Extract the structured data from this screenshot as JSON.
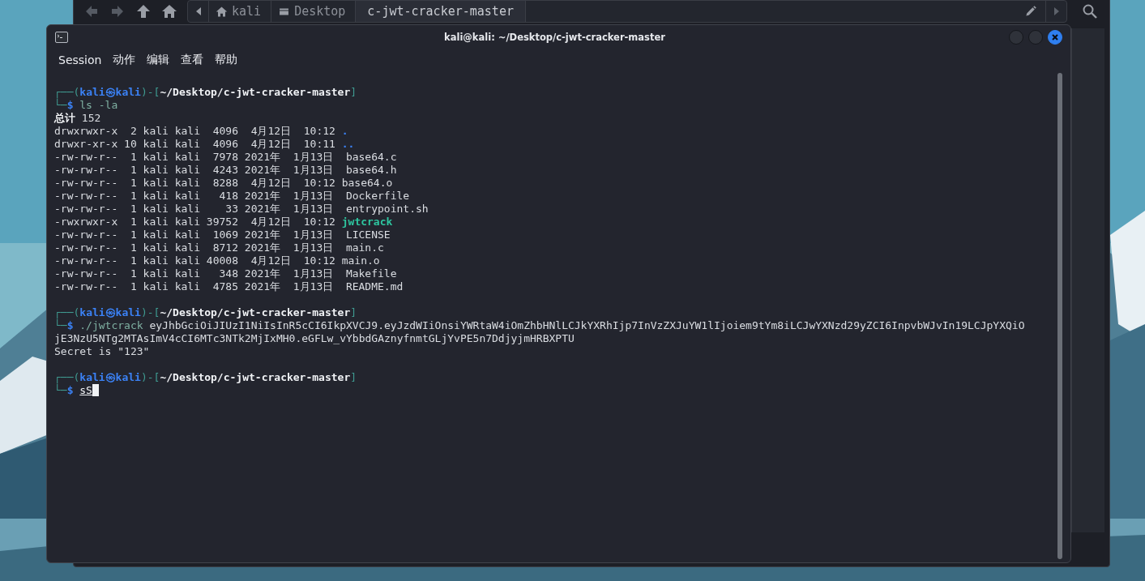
{
  "file_manager": {
    "breadcrumbs": [
      {
        "kind": "home",
        "label": "kali",
        "selected": false
      },
      {
        "kind": "drive",
        "label": "Desktop",
        "selected": false
      },
      {
        "kind": "folder",
        "label": "c-jwt-cracker-master",
        "selected": true
      }
    ]
  },
  "terminal": {
    "title": "kali@kali: ~/Desktop/c-jwt-cracker-master",
    "menu": [
      "Session",
      "动作",
      "编辑",
      "查看",
      "帮助"
    ],
    "cursor_visible": true,
    "blocks": [
      {
        "lines": [
          {
            "segments": [
              {
                "kind": "frame",
                "text": "┌──("
              },
              {
                "kind": "user",
                "text": "kali㉿kali"
              },
              {
                "kind": "frame",
                "text": ")-["
              },
              {
                "kind": "path",
                "text": "~/Desktop/c-jwt-cracker-master"
              },
              {
                "kind": "frame",
                "text": "]"
              }
            ]
          },
          {
            "segments": [
              {
                "kind": "frame",
                "text": "└─"
              },
              {
                "kind": "sign",
                "text": "$"
              },
              {
                "kind": "command",
                "text": "ls -la"
              }
            ]
          },
          {
            "segments": [
              {
                "kind": "heading",
                "text": "总计"
              },
              {
                "kind": "output",
                "text": " 152"
              }
            ]
          },
          {
            "segments": [
              {
                "kind": "output",
                "text": "drwxrwxr-x  2 kali kali  4096  4月12日  10:12 "
              },
              {
                "kind": "dir",
                "text": "."
              }
            ]
          },
          {
            "segments": [
              {
                "kind": "output",
                "text": "drwxr-xr-x 10 kali kali  4096  4月12日  10:11 "
              },
              {
                "kind": "dir",
                "text": ".."
              }
            ]
          },
          {
            "segments": [
              {
                "kind": "output",
                "text": "-rw-rw-r--  1 kali kali  7978 2021年  1月13日  base64.c"
              }
            ]
          },
          {
            "segments": [
              {
                "kind": "output",
                "text": "-rw-rw-r--  1 kali kali  4243 2021年  1月13日  base64.h"
              }
            ]
          },
          {
            "segments": [
              {
                "kind": "output",
                "text": "-rw-rw-r--  1 kali kali  8288  4月12日  10:12 base64.o"
              }
            ]
          },
          {
            "segments": [
              {
                "kind": "output",
                "text": "-rw-rw-r--  1 kali kali   418 2021年  1月13日  Dockerfile"
              }
            ]
          },
          {
            "segments": [
              {
                "kind": "output",
                "text": "-rw-rw-r--  1 kali kali    33 2021年  1月13日  entrypoint.sh"
              }
            ]
          },
          {
            "segments": [
              {
                "kind": "output",
                "text": "-rwxrwxr-x  1 kali kali 39752  4月12日  10:12 "
              },
              {
                "kind": "exec",
                "text": "jwtcrack"
              }
            ]
          },
          {
            "segments": [
              {
                "kind": "output",
                "text": "-rw-rw-r--  1 kali kali  1069 2021年  1月13日  LICENSE"
              }
            ]
          },
          {
            "segments": [
              {
                "kind": "output",
                "text": "-rw-rw-r--  1 kali kali  8712 2021年  1月13日  main.c"
              }
            ]
          },
          {
            "segments": [
              {
                "kind": "output",
                "text": "-rw-rw-r--  1 kali kali 40008  4月12日  10:12 main.o"
              }
            ]
          },
          {
            "segments": [
              {
                "kind": "output",
                "text": "-rw-rw-r--  1 kali kali   348 2021年  1月13日  Makefile"
              }
            ]
          },
          {
            "segments": [
              {
                "kind": "output",
                "text": "-rw-rw-r--  1 kali kali  4785 2021年  1月13日  README.md"
              }
            ]
          }
        ]
      },
      {
        "lines": [
          {
            "segments": [
              {
                "kind": "frame",
                "text": "┌──("
              },
              {
                "kind": "user",
                "text": "kali㉿kali"
              },
              {
                "kind": "frame",
                "text": ")-["
              },
              {
                "kind": "path",
                "text": "~/Desktop/c-jwt-cracker-master"
              },
              {
                "kind": "frame",
                "text": "]"
              }
            ]
          },
          {
            "segments": [
              {
                "kind": "frame",
                "text": "└─"
              },
              {
                "kind": "sign",
                "text": "$"
              },
              {
                "kind": "command",
                "text": "./jwtcrack"
              },
              {
                "kind": "output",
                "text": " eyJhbGciOiJIUzI1NiIsInR5cCI6IkpXVCJ9.eyJzdWIiOnsiYWRtaW4iOmZhbHNlLCJkYXRhIjp7InVzZXJuYW1lIjoiem9tYm8iLCJwYXNzd29yZCI6InpvbWJvIn19LCJpYXQiO"
              }
            ]
          },
          {
            "segments": [
              {
                "kind": "output",
                "text": "jE3NzU5NTg2MTAsImV4cCI6MTc3NTk2MjIxMH0.eGFLw_vYbbdGAznyfnmtGLjYvPE5n7DdjyjmHRBXPTU"
              }
            ]
          },
          {
            "segments": [
              {
                "kind": "output",
                "text": "Secret is \"123\""
              }
            ]
          }
        ]
      },
      {
        "lines": [
          {
            "segments": [
              {
                "kind": "frame",
                "text": "┌──("
              },
              {
                "kind": "user",
                "text": "kali㉿kali"
              },
              {
                "kind": "frame",
                "text": ")-["
              },
              {
                "kind": "path",
                "text": "~/Desktop/c-jwt-cracker-master"
              },
              {
                "kind": "frame",
                "text": "]"
              }
            ]
          },
          {
            "segments": [
              {
                "kind": "frame",
                "text": "└─"
              },
              {
                "kind": "sign",
                "text": "$"
              },
              {
                "kind": "typed",
                "text": "sS"
              }
            ]
          }
        ]
      }
    ]
  }
}
